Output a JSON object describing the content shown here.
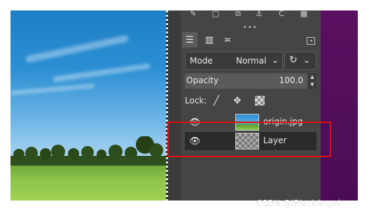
{
  "canvas": {
    "image_description_icon": "landscape-photo"
  },
  "toolbar_icons": [
    "edit-icon",
    "new-icon",
    "duplicate-icon",
    "anchor-icon",
    "reset-icon",
    "delete-icon"
  ],
  "tabs": [
    {
      "icon": "layers-icon",
      "glyph": "☰"
    },
    {
      "icon": "channels-icon",
      "glyph": "▥"
    },
    {
      "icon": "paths-icon",
      "glyph": "≍"
    }
  ],
  "tab_menu_glyph": "◂",
  "mode": {
    "label": "Mode",
    "value": "Normal",
    "chevron": "⌄"
  },
  "reset_glyph": "↻",
  "reset_chevron": "⌄",
  "opacity": {
    "label": "Opacity",
    "value": "100.0",
    "up": "▲",
    "down": "▼"
  },
  "lock": {
    "label": "Lock:",
    "pixels_glyph": "╱",
    "position_glyph": "✥"
  },
  "layers": [
    {
      "name": "origin.jpg",
      "visible_glyph": "👁",
      "thumb": "photo",
      "selected": false
    },
    {
      "name": "Layer",
      "visible_glyph": "👁",
      "thumb": "transparent",
      "selected": true
    }
  ],
  "watermark": "CSDN @iBlackAngel",
  "colors": {
    "panel_bg": "#454545",
    "highlight": "#e01010",
    "purple_bg": "#5a1060"
  }
}
